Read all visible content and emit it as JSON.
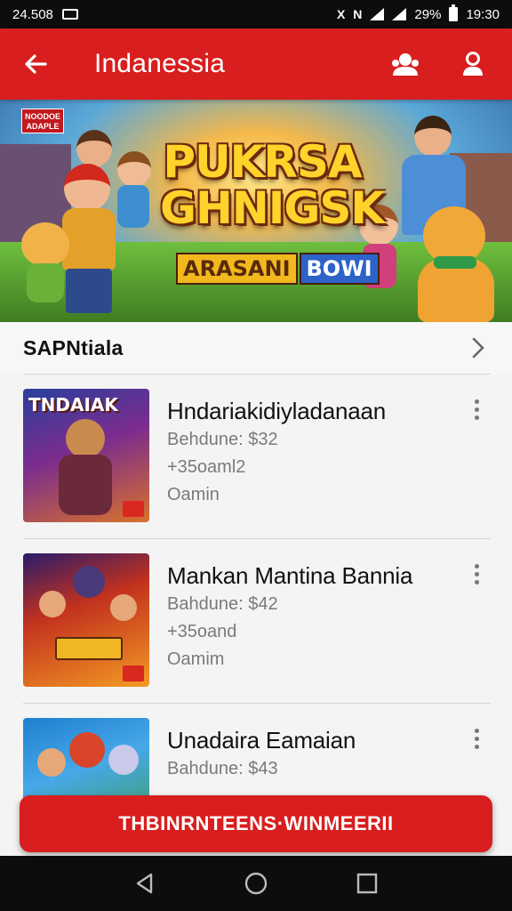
{
  "status_bar": {
    "time_left": "24.508",
    "battery": "29%",
    "time_right": "19:30",
    "glyph_1": "X",
    "glyph_2": "N"
  },
  "app_bar": {
    "title": "Indanessia",
    "back_icon": "arrow-left-icon",
    "action_icons": [
      "group-icon",
      "profile-icon"
    ]
  },
  "banner": {
    "badge": "NOODOE ADAPLE",
    "title_line1": "PUKRSA",
    "title_line2": "GHNIGSK",
    "sub_left": "ARASANI",
    "sub_right": "BOWI"
  },
  "section": {
    "title": "SAPNtiala"
  },
  "games": [
    {
      "thumb_label": "TNDAIAK",
      "title": "Hndariakidіyladanaan",
      "price": "Behdune: $32",
      "detail": "+35oaml2",
      "category": "Oamin"
    },
    {
      "thumb_label": "",
      "title": "Mankan Mantina Bannia",
      "price": "Bahdune: $42",
      "detail": "+35oand",
      "category": "Oamim"
    },
    {
      "thumb_label": "",
      "title": "Unadaira Eamaian",
      "price": "Bahdune: $43",
      "detail": "",
      "category": ""
    }
  ],
  "cta": {
    "label": "THBINRNTEENS·WINMEERII"
  },
  "colors": {
    "brand_red": "#d81e1e",
    "bar_black": "#0d0d0d"
  }
}
